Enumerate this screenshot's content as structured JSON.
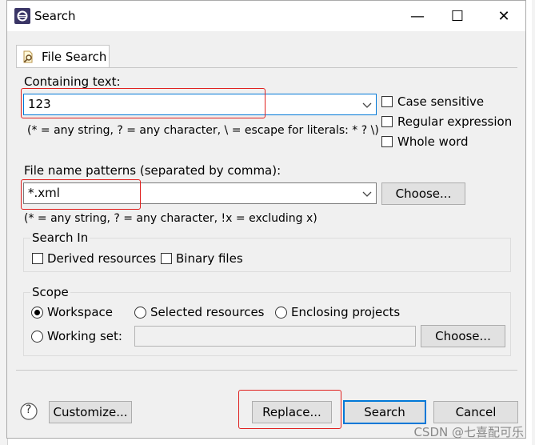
{
  "window": {
    "title": "Search",
    "minimize_glyph": "—",
    "maximize_glyph": "☐",
    "close_glyph": "✕"
  },
  "tab": {
    "label": "File Search"
  },
  "containing": {
    "label": "Containing text:",
    "value": "123",
    "hint": "(* = any string, ? = any character, \\ = escape for literals: * ? \\)",
    "options": [
      "Case sensitive",
      "Regular expression",
      "Whole word"
    ]
  },
  "patterns": {
    "label": "File name patterns (separated by comma):",
    "value": "*.xml",
    "choose_label": "Choose...",
    "hint": "(* = any string, ? = any character, !x = excluding x)"
  },
  "search_in": {
    "title": "Search In",
    "options": [
      "Derived resources",
      "Binary files"
    ]
  },
  "scope": {
    "title": "Scope",
    "options": [
      "Workspace",
      "Selected resources",
      "Enclosing projects",
      "Working set:"
    ],
    "selected": "Workspace",
    "working_set_value": "",
    "choose_label": "Choose..."
  },
  "footer": {
    "help_glyph": "?",
    "customize_label": "Customize...",
    "replace_label": "Replace...",
    "search_label": "Search",
    "cancel_label": "Cancel"
  },
  "watermark": "CSDN @七喜配可乐",
  "colors": {
    "highlight": "#e0201e",
    "focus": "#0078d7"
  },
  "icons": {
    "app": "eclipse-icon",
    "tab": "file-search-icon",
    "help": "help-icon"
  }
}
